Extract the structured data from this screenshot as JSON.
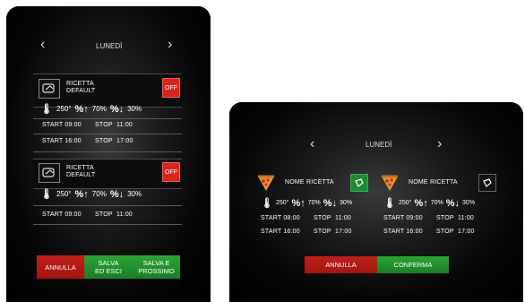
{
  "left": {
    "day": "LUNEDÌ",
    "nav_prev": "‹",
    "nav_next": "›",
    "recipes": [
      {
        "name_line1": "RICETTA",
        "name_line2": "DEFAULT",
        "status": "OFF",
        "temp": "250°",
        "hum_up": "70%",
        "hum_down": "30%",
        "start_label": "START",
        "stop_label": "STOP",
        "slots": [
          {
            "start": "09:00",
            "stop": "11:00"
          },
          {
            "start": "16:00",
            "stop": "17:00"
          }
        ]
      },
      {
        "name_line1": "RICETTA",
        "name_line2": "DEFAULT",
        "status": "OFF",
        "temp": "250°",
        "hum_up": "70%",
        "hum_down": "30%",
        "start_label": "START",
        "stop_label": "STOP",
        "slots": [
          {
            "start": "09:00",
            "stop": "11:00"
          }
        ]
      }
    ],
    "buttons": {
      "cancel": "ANNULLA",
      "save_exit_1": "SALVA",
      "save_exit_2": "ED ESCI",
      "save_next_1": "SALVA E",
      "save_next_2": "PROSSIMO"
    }
  },
  "right": {
    "day": "LUNEDÌ",
    "recipes": [
      {
        "name": "NOME RICETTA",
        "temp": "250°",
        "hum_up": "70%",
        "hum_down": "30%",
        "start_label": "START",
        "stop_label": "STOP",
        "slots": [
          {
            "start": "08:00",
            "stop": "11:00"
          },
          {
            "start": "16:00",
            "stop": "17:00"
          }
        ]
      },
      {
        "name": "NOME RICETTA",
        "temp": "250°",
        "hum_up": "70%",
        "hum_down": "30%",
        "start_label": "START",
        "stop_label": "STOP",
        "slots": [
          {
            "start": "09:00",
            "stop": "11:00"
          },
          {
            "start": "16:00",
            "stop": "17:00"
          }
        ]
      }
    ],
    "buttons": {
      "cancel": "ANNULLA",
      "confirm": "CONFERMA"
    }
  },
  "colors": {
    "red": "#c0201a",
    "green": "#2ba437"
  },
  "icons": [
    "chevron-left-icon",
    "chevron-right-icon",
    "thermometer-icon",
    "humidity-up-icon",
    "humidity-down-icon",
    "recipe-icon",
    "pizza-icon"
  ]
}
